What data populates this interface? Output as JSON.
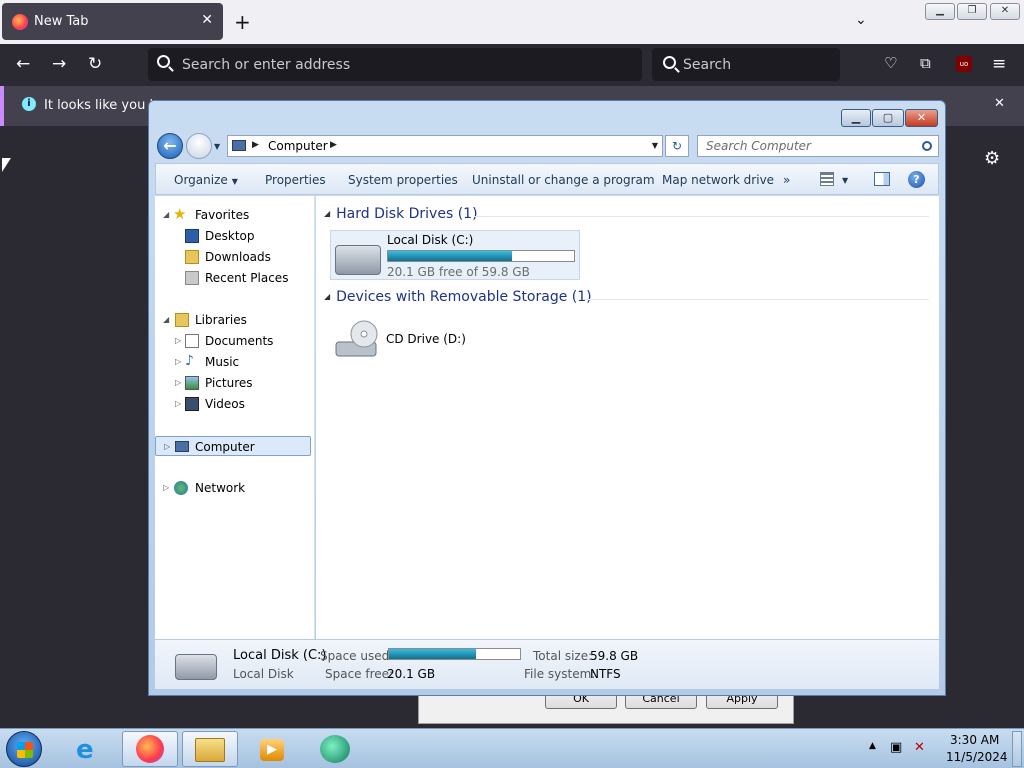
{
  "firefox": {
    "tab_title": "New Tab",
    "address_placeholder": "Search or enter address",
    "search_placeholder": "Search",
    "notification_text": "It looks like you hav",
    "ublock_label": "uo"
  },
  "bg_dialog": {
    "ok": "OK",
    "cancel": "Cancel",
    "apply": "Apply"
  },
  "explorer": {
    "address_path": "Computer",
    "search_placeholder": "Search Computer",
    "commands": [
      "Organize",
      "Properties",
      "System properties",
      "Uninstall or change a program",
      "Map network drive"
    ],
    "more_commands": "»",
    "nav": {
      "favorites": "Favorites",
      "favorites_items": [
        "Desktop",
        "Downloads",
        "Recent Places"
      ],
      "libraries": "Libraries",
      "libraries_items": [
        "Documents",
        "Music",
        "Pictures",
        "Videos"
      ],
      "computer": "Computer",
      "network": "Network"
    },
    "groups": {
      "hdd": "Hard Disk Drives (1)",
      "removable": "Devices with Removable Storage (1)"
    },
    "local_disk": {
      "name": "Local Disk (C:)",
      "free_text": "20.1 GB free of 59.8 GB",
      "used_fraction": 0.664
    },
    "cd_drive": {
      "name": "CD Drive (D:)"
    },
    "details": {
      "name": "Local Disk (C:)",
      "type": "Local Disk",
      "space_used_label": "Space used:",
      "space_free_label": "Space free:",
      "space_free": "20.1 GB",
      "total_size_label": "Total size:",
      "total_size": "59.8 GB",
      "file_system_label": "File system:",
      "file_system": "NTFS"
    }
  },
  "taskbar": {
    "time": "3:30 AM",
    "date": "11/5/2024"
  },
  "colors": {
    "accent": "#1e3287",
    "selection": "#dbe9fb"
  }
}
